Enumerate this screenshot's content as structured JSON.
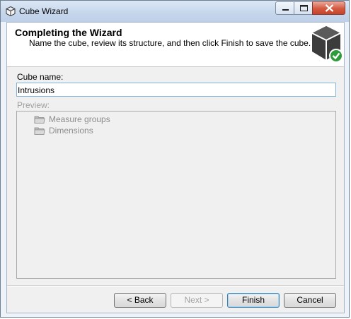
{
  "window": {
    "title": "Cube Wizard"
  },
  "header": {
    "title": "Completing the Wizard",
    "subtitle": "Name the cube, review its structure, and then click Finish to save the cube."
  },
  "form": {
    "cube_name_label": "Cube name:",
    "cube_name_value": "Intrusions",
    "preview_label": "Preview:"
  },
  "preview": {
    "items": [
      {
        "label": "Measure groups",
        "icon": "folder-icon"
      },
      {
        "label": "Dimensions",
        "icon": "folder-icon"
      }
    ]
  },
  "buttons": {
    "back": "< Back",
    "next": "Next >",
    "finish": "Finish",
    "cancel": "Cancel"
  },
  "colors": {
    "checkmark": "#2e9c3a",
    "cube": "#3c3c3c"
  }
}
